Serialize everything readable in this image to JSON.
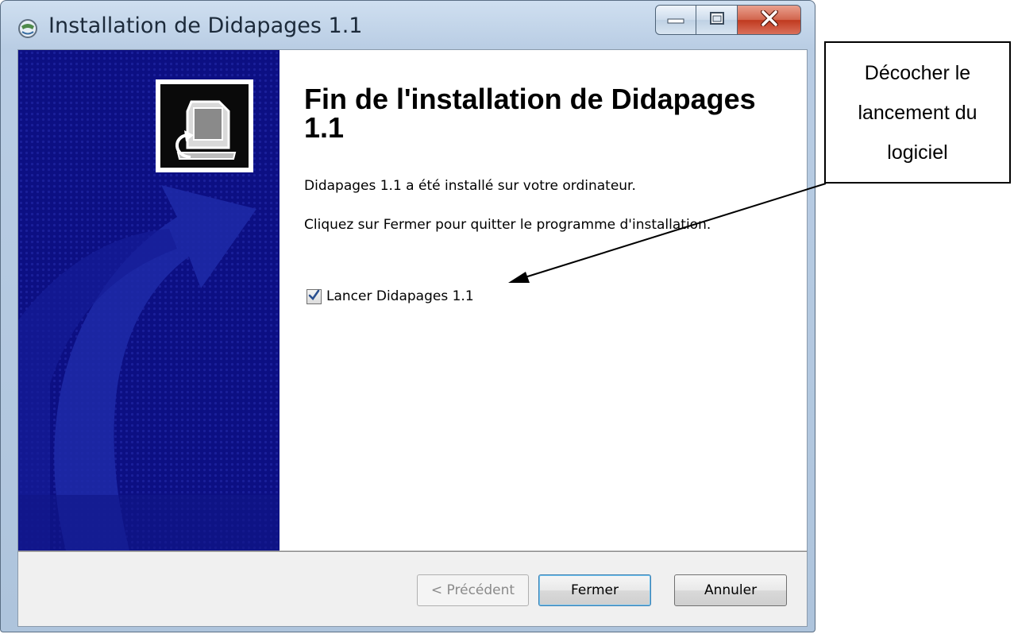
{
  "window": {
    "title": "Installation de Didapages 1.1"
  },
  "content": {
    "heading": "Fin de l'installation de Didapages 1.1",
    "message_installed": "Didapages 1.1 a été installé sur votre ordinateur.",
    "message_close": "Cliquez sur Fermer pour quitter le programme d'installation.",
    "launch_checkbox": {
      "label": "Lancer Didapages 1.1",
      "checked": true
    }
  },
  "buttons": {
    "previous": "< Précédent",
    "close": "Fermer",
    "cancel": "Annuler"
  },
  "annotation": {
    "lines": [
      "Décocher le",
      "lancement du",
      "logiciel"
    ]
  },
  "colors": {
    "banner_blue": "#0c0f83",
    "close_button_red": "#c0391f"
  },
  "icons": [
    "installer-globe-icon",
    "minimize-icon",
    "maximize-icon",
    "close-icon",
    "installer-computer-icon",
    "checkmark-icon"
  ]
}
